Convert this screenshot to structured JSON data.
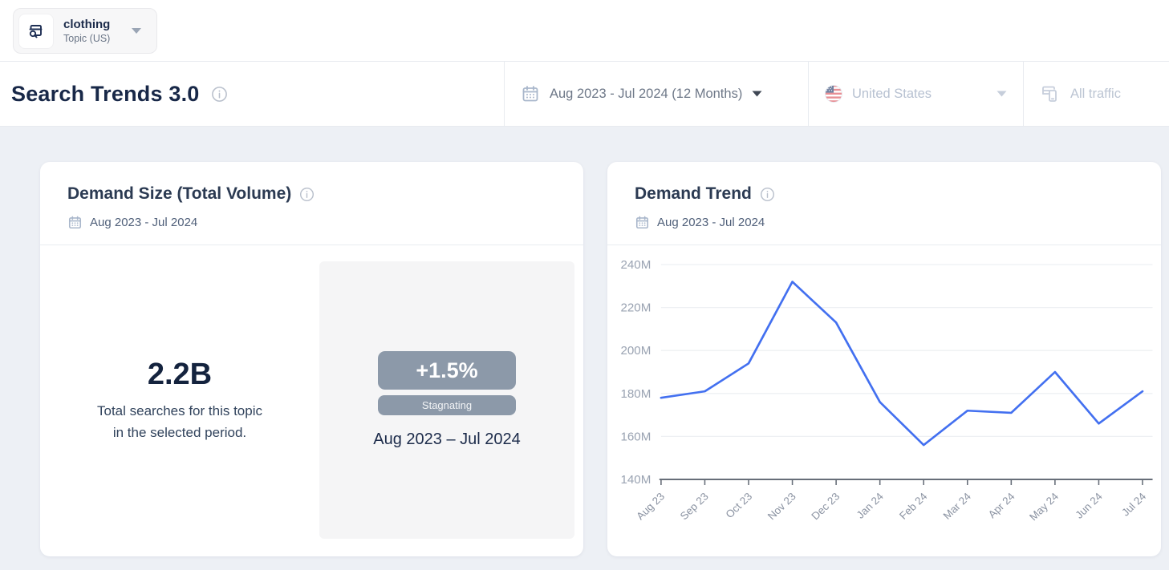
{
  "topbar": {
    "entity_name": "clothing",
    "entity_type": "Topic (US)"
  },
  "header": {
    "title": "Search Trends 3.0",
    "date_range": "Aug 2023 - Jul 2024 (12 Months)",
    "country": "United States",
    "traffic": "All traffic"
  },
  "demand_size": {
    "title": "Demand Size (Total Volume)",
    "date_range": "Aug 2023 - Jul 2024",
    "total": "2.2B",
    "description_line1": "Total searches for this topic",
    "description_line2": "in the selected period.",
    "change": "+1.5%",
    "trend_label": "Stagnating",
    "period": "Aug 2023 – Jul 2024"
  },
  "demand_trend": {
    "title": "Demand Trend",
    "date_range": "Aug 2023 - Jul 2024"
  },
  "chart_data": {
    "type": "line",
    "title": "Demand Trend",
    "categories": [
      "Aug 23",
      "Sep 23",
      "Oct 23",
      "Nov 23",
      "Dec 23",
      "Jan 24",
      "Feb 24",
      "Mar 24",
      "Apr 24",
      "May 24",
      "Jun 24",
      "Jul 24"
    ],
    "values": [
      178,
      181,
      194,
      232,
      213,
      176,
      156,
      172,
      171,
      190,
      166,
      181
    ],
    "unit": "M",
    "ylim": [
      140,
      240
    ],
    "yticks": [
      140,
      160,
      180,
      200,
      220,
      240
    ],
    "xlabel": "",
    "ylabel": "",
    "grid": true,
    "legend": "none",
    "line_color": "#4370f0"
  },
  "icons": {
    "entity": "topic-search-icon",
    "date": "calendar-icon",
    "info": "info-icon",
    "country": "us-flag-icon",
    "traffic": "devices-icon"
  },
  "colors": {
    "accent_line": "#4370f0",
    "badge_gray": "#8c99a9",
    "navy_text": "#1c2b4a",
    "page_bg": "#edf0f5",
    "panel_bg": "#f5f5f6",
    "axis_label": "#9aa3b2"
  }
}
